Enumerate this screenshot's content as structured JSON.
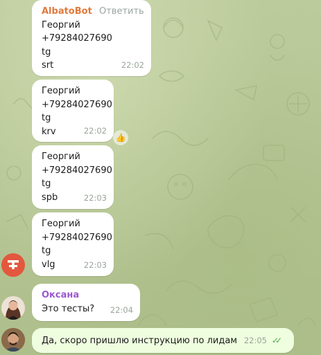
{
  "messages": [
    {
      "sender": "AlbatoBot",
      "reply_label": "Ответить",
      "lines": [
        "Георгий",
        "+79284027690",
        "tg",
        "srt"
      ],
      "time": "22:02"
    },
    {
      "lines": [
        "Георгий",
        "+79284027690",
        "tg",
        "krv"
      ],
      "time": "22:02",
      "reaction": "👍"
    },
    {
      "lines": [
        "Георгий",
        "+79284027690",
        "tg",
        "spb"
      ],
      "time": "22:03"
    },
    {
      "lines": [
        "Георгий",
        "+79284027690",
        "tg",
        "vlg"
      ],
      "time": "22:03"
    },
    {
      "sender": "Оксана",
      "lines": [
        "Это тесты?"
      ],
      "time": "22:04"
    },
    {
      "lines": [
        "Да, скоро пришлю инструкцию по лидам"
      ],
      "time": "22:05",
      "status": "read"
    }
  ],
  "colors": {
    "bot_name": "#e17a3c",
    "oksana_name": "#9b59d0",
    "bot_avatar": "#e2583e",
    "read_checks": "#4fae4e"
  },
  "icons": {
    "bot_avatar": "bot-logo-icon",
    "reaction": "thumbs-up-icon",
    "status": "double-check-icon"
  }
}
